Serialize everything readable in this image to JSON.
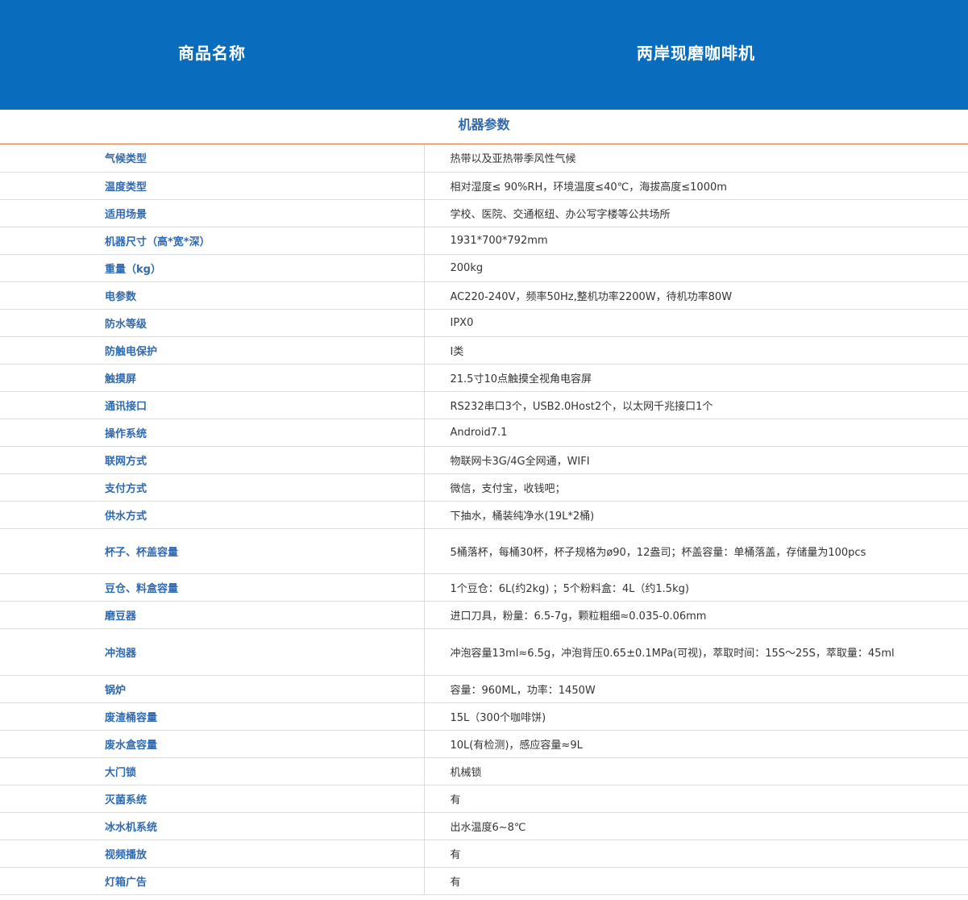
{
  "header": {
    "label": "商品名称",
    "value": "两岸现磨咖啡机"
  },
  "section_title": "机器参数",
  "colors": {
    "header_bg": "#0a6cbd",
    "key_text": "#2f69b0",
    "divider_accent": "#e07a3c"
  },
  "rows": [
    {
      "key": "气候类型",
      "value": "热带以及亚热带季风性气候"
    },
    {
      "key": "温度类型",
      "value": "相对湿度≤ 90%RH，环境温度≤40℃，海拔高度≤1000m"
    },
    {
      "key": "适用场景",
      "value": "学校、医院、交通枢纽、办公写字楼等公共场所"
    },
    {
      "key": "机器尺寸（高*宽*深）",
      "value": "1931*700*792mm"
    },
    {
      "key": "重量（kg）",
      "value": "200kg"
    },
    {
      "key": "电参数",
      "value": "AC220-240V，频率50Hz,整机功率2200W，待机功率80W"
    },
    {
      "key": "防水等级",
      "value": "IPX0"
    },
    {
      "key": "防触电保护",
      "value": "Ⅰ类"
    },
    {
      "key": "触摸屏",
      "value": "21.5寸10点触摸全视角电容屏"
    },
    {
      "key": "通讯接口",
      "value": "RS232串口3个，USB2.0Host2个，以太网千兆接口1个"
    },
    {
      "key": "操作系统",
      "value": "Android7.1"
    },
    {
      "key": "联网方式",
      "value": "物联网卡3G/4G全网通，WIFI"
    },
    {
      "key": "支付方式",
      "value": "微信，支付宝，收钱吧；"
    },
    {
      "key": "供水方式",
      "value": "下抽水，桶装纯净水(19L*2桶)"
    },
    {
      "key": "杯子、杯盖容量",
      "value": "5桶落杯，每桶30杯，杯子规格为ø90，12盎司；杯盖容量：单桶落盖，存储量为100pcs"
    },
    {
      "key": "豆仓、料盒容量",
      "value": "1个豆仓：6L(约2kg) ；5个粉料盒：4L（约1.5kg)"
    },
    {
      "key": "磨豆器",
      "value": "进口刀具，粉量：6.5-7g，颗粒粗细≈0.035-0.06mm"
    },
    {
      "key": "冲泡器",
      "value": "冲泡容量13ml≈6.5g，冲泡背压0.65±0.1MPa(可视)，萃取时间：15S～25S，萃取量：45ml"
    },
    {
      "key": "锅炉",
      "value": "容量：960ML，功率：1450W"
    },
    {
      "key": "废渣桶容量",
      "value": "15L（300个咖啡饼)"
    },
    {
      "key": "废水盒容量",
      "value": "10L(有检测)，感应容量≈9L"
    },
    {
      "key": "大门锁",
      "value": "机械锁"
    },
    {
      "key": "灭菌系统",
      "value": "有"
    },
    {
      "key": "冰水机系统",
      "value": "出水温度6~8℃"
    },
    {
      "key": "视频播放",
      "value": "有"
    },
    {
      "key": "灯箱广告",
      "value": "有"
    }
  ]
}
